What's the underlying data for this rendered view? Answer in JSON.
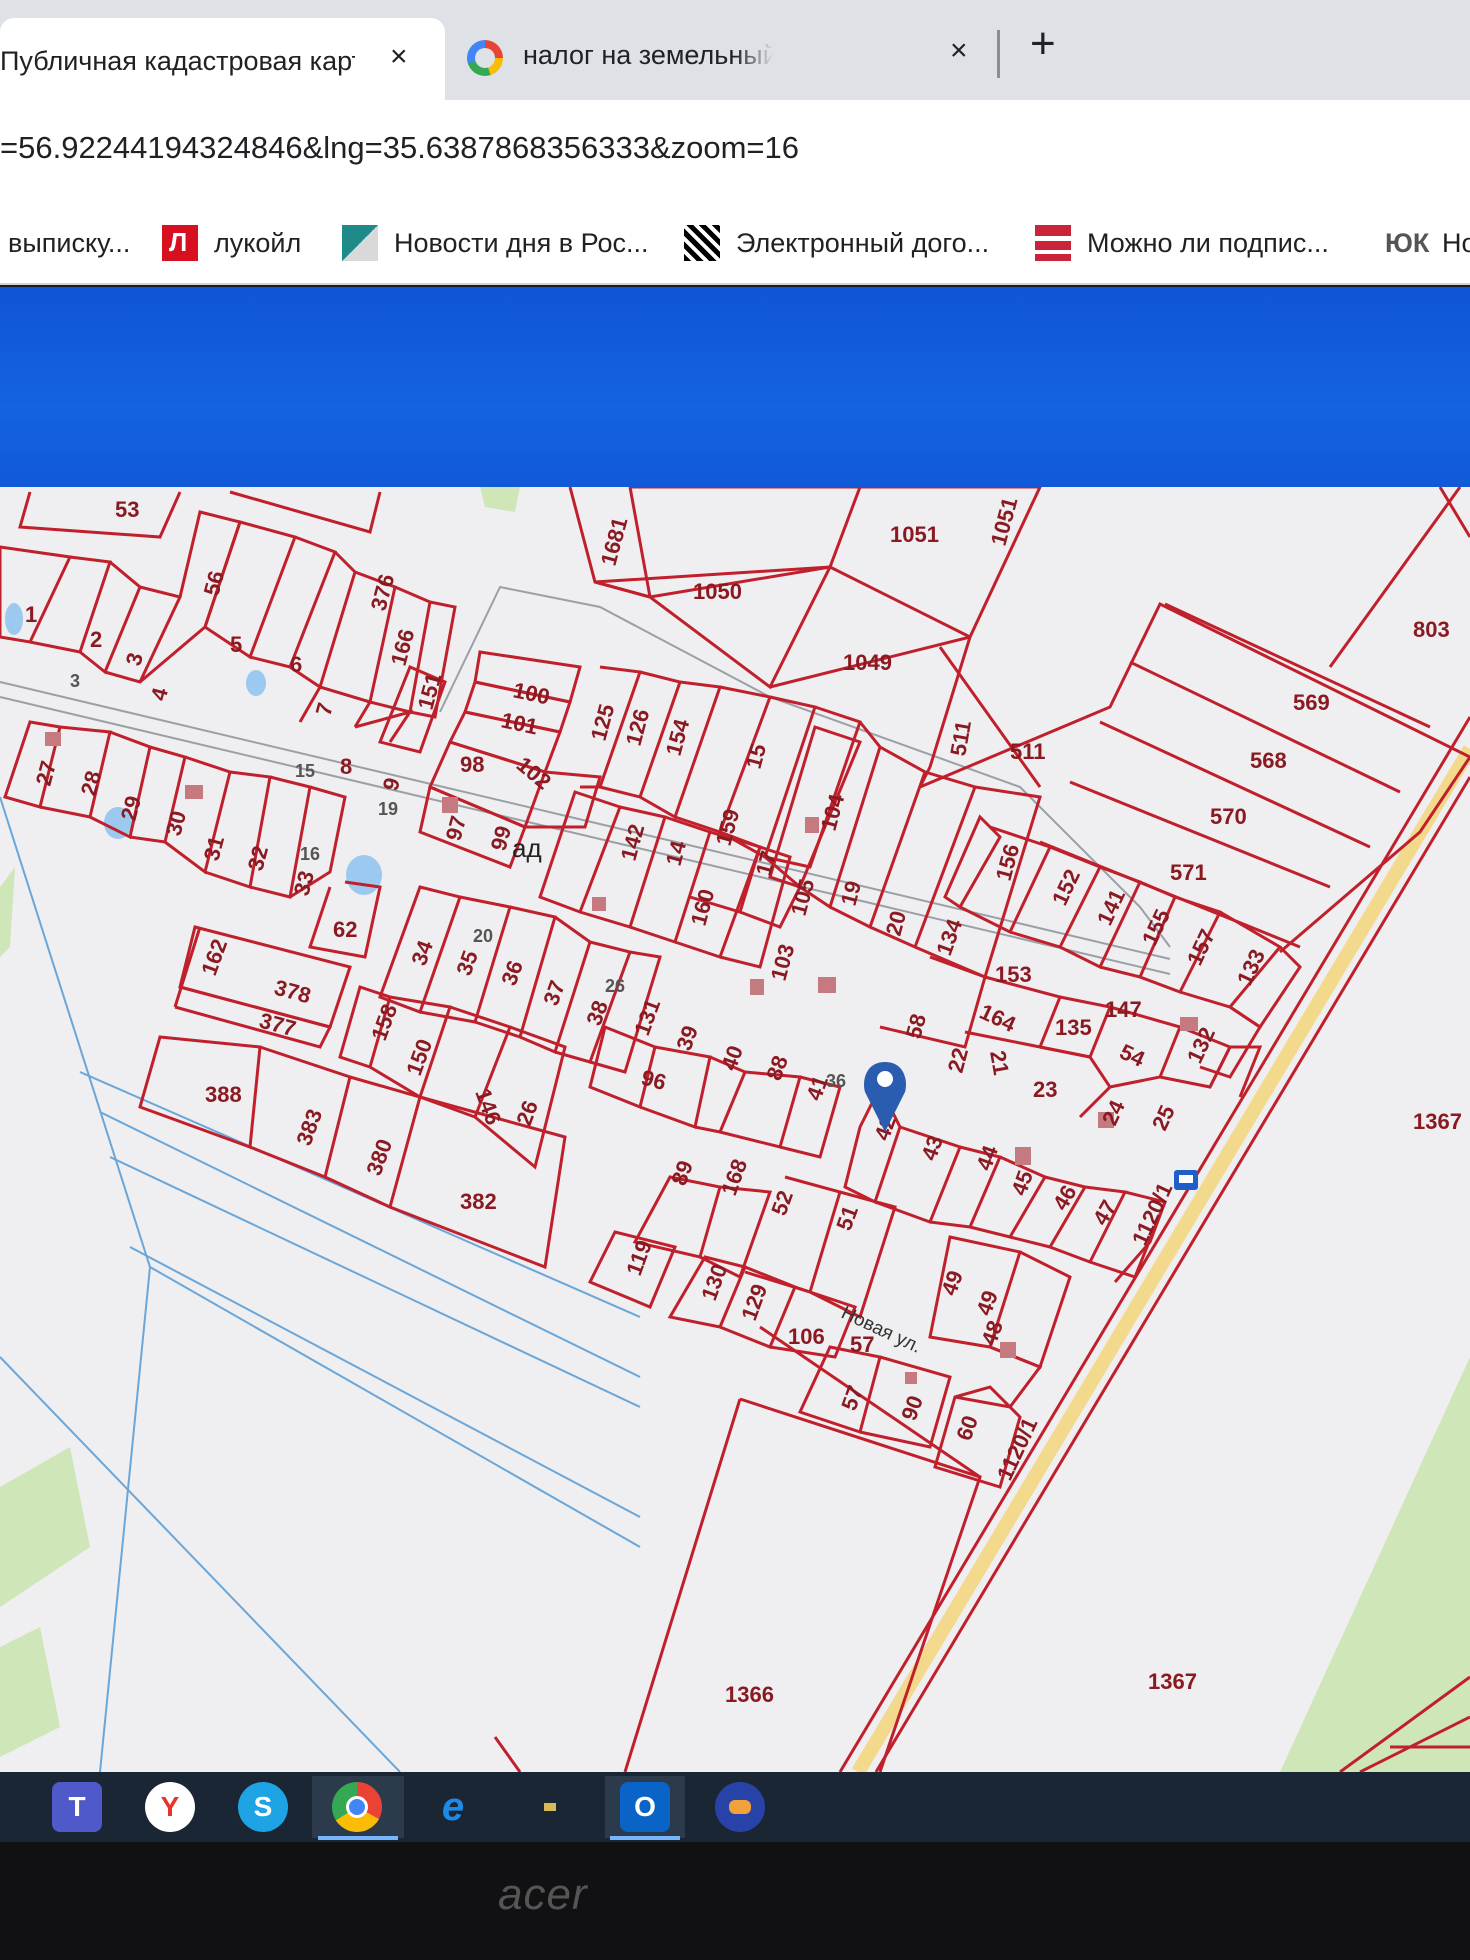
{
  "browser": {
    "tabs": [
      {
        "title": "Публичная кадастровая карта",
        "active": true
      },
      {
        "title": "налог на земельный участок тв",
        "active": false
      }
    ],
    "close_icon": "×",
    "new_tab_icon": "+",
    "url": "=56.92244194324846&lng=35.6387868356333&zoom=16",
    "bookmarks": [
      {
        "label": "выписку..."
      },
      {
        "label": "лукойл"
      },
      {
        "label": "Новости дня в Рос..."
      },
      {
        "label": "Электронный дого..."
      },
      {
        "label": "Можно ли подпис..."
      },
      {
        "label": "ЮК"
      },
      {
        "label": "Но"
      }
    ]
  },
  "map": {
    "street_name": "Новая ул.",
    "road_code": "1120/1",
    "village_label": "ад",
    "marker_icon": "map-pin",
    "colors": {
      "boundary": "#c0202c",
      "label": "#8a1a22",
      "road": "#f2d98c",
      "green": "#cfe6b8",
      "water": "#9cc9ef"
    },
    "plots": [
      "53",
      "1681",
      "1051",
      "1051",
      "1050",
      "1049",
      "803",
      "569",
      "568",
      "570",
      "571",
      "511",
      "511",
      "1",
      "2",
      "3",
      "3",
      "4",
      "56",
      "5",
      "6",
      "7",
      "376",
      "166",
      "151",
      "8",
      "9",
      "15",
      "19",
      "100",
      "101",
      "102",
      "98",
      "97",
      "99",
      "125",
      "126",
      "154",
      "15",
      "159",
      "17",
      "104",
      "105",
      "19",
      "20",
      "27",
      "28",
      "29",
      "30",
      "31",
      "32",
      "33",
      "16",
      "62",
      "142",
      "14",
      "160",
      "103",
      "156",
      "152",
      "141",
      "155",
      "157",
      "133",
      "34",
      "35",
      "36",
      "37",
      "38",
      "20",
      "26",
      "131",
      "39",
      "40",
      "88",
      "41",
      "134",
      "153",
      "147",
      "164",
      "135",
      "54",
      "132",
      "58",
      "22",
      "21",
      "23",
      "24",
      "25",
      "162",
      "378",
      "377",
      "158",
      "150",
      "146",
      "26",
      "388",
      "383",
      "380",
      "382",
      "96",
      "36",
      "42",
      "43",
      "44",
      "45",
      "46",
      "47",
      "89",
      "168",
      "52",
      "51",
      "119",
      "130",
      "129",
      "106",
      "57",
      "57",
      "90",
      "49",
      "49",
      "48",
      "60",
      "1367",
      "1366",
      "1367"
    ]
  },
  "taskbar": {
    "apps": [
      "teams-icon",
      "yandex-icon",
      "skype-icon",
      "chrome-icon",
      "edge-icon",
      "mail-icon",
      "outlook-icon",
      "aimp-icon"
    ],
    "letters": {
      "teams": "T",
      "yandex": "Y",
      "skype": "S",
      "outlook": "O"
    }
  },
  "monitor_brand": "acer"
}
